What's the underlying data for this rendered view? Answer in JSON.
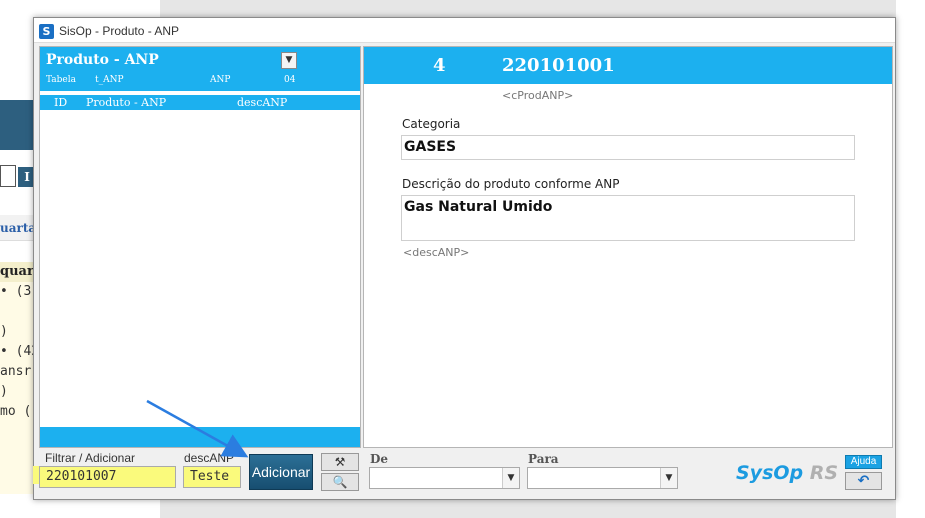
{
  "window": {
    "title": "SisOp - Produto - ANP",
    "icon": "app-logo-icon"
  },
  "background_app": {
    "button_label": "I",
    "tab_label": "uarta",
    "code_lines": [
      "quar",
      "• (3)",
      "",
      ")",
      "• (42",
      "ansr",
      ")",
      "mo ("
    ]
  },
  "left_panel": {
    "title": "Produto - ANP",
    "dropdown_icon": "chevron-down-icon",
    "sub_tabela": "Tabela",
    "sub_table_name": "t_ANP",
    "sub_anp": "ANP",
    "sub_count": "04",
    "columns": [
      "ID",
      "Produto - ANP",
      "descANP"
    ]
  },
  "right_panel": {
    "record_number": "4",
    "record_code": "220101001",
    "code_tag": "<cProdANP>",
    "categoria_label": "Categoria",
    "categoria_value": "GASES",
    "descricao_label": "Descrição do produto conforme ANP",
    "descricao_value": "Gas Natural Umido",
    "desc_tag": "<descANP>"
  },
  "toolbar": {
    "filter_label": "Filtrar / Adicionar",
    "filter_value": "220101007",
    "desc_label": "descANP",
    "desc_value": "Teste",
    "add_label": "Adicionar",
    "tool1_icon": "tools-icon",
    "tool2_icon": "search-document-icon",
    "de_label": "De",
    "para_label": "Para",
    "brand_1": "SysOp",
    "brand_2": "RS",
    "help_label": "Ajuda",
    "back_icon": "undo-icon"
  },
  "colors": {
    "accent": "#1cb0ef",
    "button": "#1f5d82",
    "highlight": "#fafa7c",
    "annotation_arrow": "#2b7de0"
  }
}
